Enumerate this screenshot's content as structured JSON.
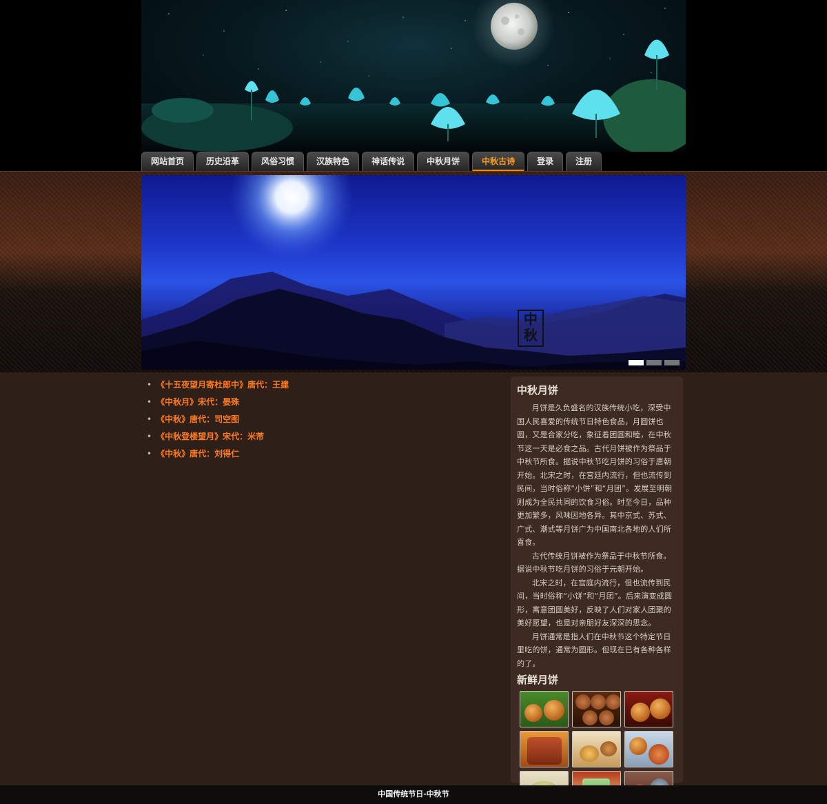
{
  "nav": {
    "items": [
      "网站首页",
      "历史沿革",
      "风俗习惯",
      "汉族特色",
      "神话传说",
      "中秋月饼",
      "中秋古诗",
      "登录",
      "注册"
    ],
    "active_index": 6,
    "active_color": "#ff9b21"
  },
  "slider": {
    "seal_text": "中秋",
    "dot_count": 3,
    "active_dot": 0
  },
  "poems": [
    "《十五夜望月寄杜郎中》唐代：王建",
    "《中秋月》宋代：晏殊",
    "《中秋》唐代：司空图",
    "《中秋登楼望月》宋代：米芾",
    "《中秋》唐代：刘得仁"
  ],
  "sidebar": {
    "title": "中秋月饼",
    "paragraphs": [
      "月饼是久负盛名的汉族传统小吃，深受中国人民喜爱的传统节日特色食品，月圆饼也圆，又是合家分吃，象征着团圆和睦，在中秋节这一天是必食之品。古代月饼被作为祭品于中秋节所食。据说中秋节吃月饼的习俗于唐朝开始。北宋之时，在宫廷内流行，但也流传到民间，当时俗称“小饼”和“月团”。发展至明朝则成为全民共同的饮食习俗。时至今日，品种更加繁多，风味因地各异。其中京式、苏式、广式、潮式等月饼广为中国南北各地的人们所喜食。",
      "古代传统月饼被作为祭品于中秋节所食。据说中秋节吃月饼的习俗于元朝开始。",
      "北宋之时，在宫庭内流行，但也流传到民间，当时俗称“小饼”和“月团”。后来演变成圆形，寓意团圆美好，反映了人们对家人团聚的美好愿望，也是对亲朋好友深深的思念。",
      "月饼通常是指人们在中秋节这个特定节日里吃的饼，通常为圆形。但现在已有各种各样的了。"
    ],
    "gallery_title": "新鲜月饼",
    "gallery_icons": [
      "mooncake-photo",
      "mooncake-photo",
      "mooncake-photo",
      "mooncake-photo",
      "mooncake-photo",
      "mooncake-photo",
      "mooncake-photo",
      "mooncake-photo",
      "mooncake-photo"
    ]
  },
  "footer": {
    "text": "中国传统节日-中秋节"
  },
  "colors": {
    "page_bg": "#2e1f19",
    "poem_link": "#ff7a1f",
    "sidebar_bg": "#3d2a22"
  }
}
